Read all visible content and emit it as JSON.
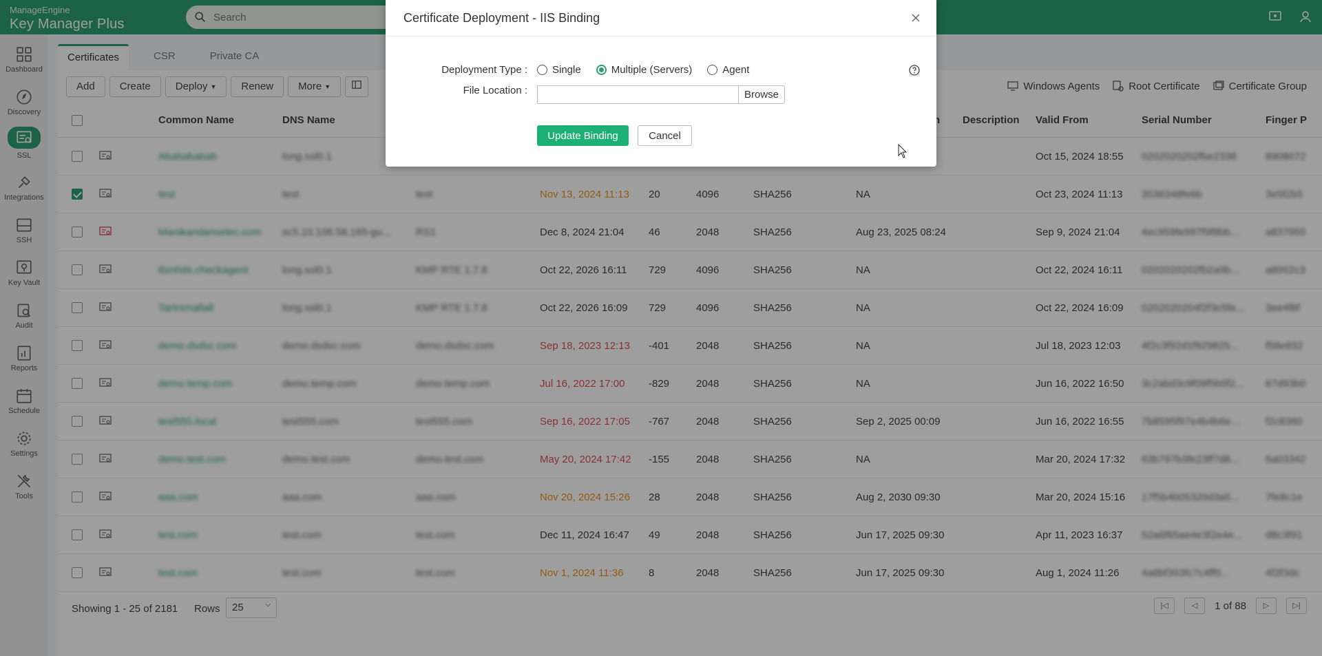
{
  "brand": {
    "vendor": "ManageEngine",
    "product": "Key Manager Plus"
  },
  "search": {
    "placeholder": "Search"
  },
  "sidebar": {
    "items": [
      {
        "label": "Dashboard",
        "icon": "dashboard-icon"
      },
      {
        "label": "Discovery",
        "icon": "discovery-icon"
      },
      {
        "label": "SSL",
        "icon": "ssl-icon",
        "active": true
      },
      {
        "label": "Integrations",
        "icon": "integrations-icon"
      },
      {
        "label": "SSH",
        "icon": "ssh-icon"
      },
      {
        "label": "Key Vault",
        "icon": "key-vault-icon"
      },
      {
        "label": "Audit",
        "icon": "audit-icon"
      },
      {
        "label": "Reports",
        "icon": "reports-icon"
      },
      {
        "label": "Schedule",
        "icon": "schedule-icon"
      },
      {
        "label": "Settings",
        "icon": "settings-icon"
      },
      {
        "label": "Tools",
        "icon": "tools-icon"
      }
    ]
  },
  "tabs": [
    {
      "label": "Certificates",
      "active": true
    },
    {
      "label": "CSR"
    },
    {
      "label": "Private CA"
    }
  ],
  "toolbar": {
    "add": "Add",
    "create": "Create",
    "deploy": "Deploy",
    "renew": "Renew",
    "more": "More"
  },
  "right_links": {
    "windows_agents": "Windows Agents",
    "root_certificate": "Root Certificate",
    "certificate_group": "Certificate Group"
  },
  "table": {
    "headers": {
      "common_name": "Common Name",
      "dns_name": "DNS Name",
      "col6_partial": "n",
      "description": "Description",
      "valid_from": "Valid From",
      "serial_number": "Serial Number",
      "finger": "Finger P"
    },
    "rows": [
      {
        "checked": false,
        "cn": "Ababababab",
        "dns": "long.ssl0.1",
        "issuer": "",
        "expiry": "",
        "expiry_color": "",
        "days": "",
        "key": "",
        "alg": "",
        "other": "",
        "valid_from": "Oct 15, 2024 18:55",
        "serial": "0202020202fbe2338",
        "finger": "8908072"
      },
      {
        "checked": true,
        "cn": "test",
        "dns": "test",
        "issuer": "test",
        "expiry": "Nov 13, 2024 11:13",
        "expiry_color": "orange",
        "days": "20",
        "key": "4096",
        "alg": "SHA256",
        "other": "NA",
        "valid_from": "Oct 23, 2024 11:13",
        "serial": "3536348fe6b",
        "finger": "3e5f2b5"
      },
      {
        "checked": false,
        "cn": "Manikandanselec.com",
        "dns": "sc5.10.106.58.165-gu...",
        "issuer": "RS1",
        "expiry": "Dec 8, 2024 21:04",
        "expiry_color": "",
        "days": "46",
        "key": "2048",
        "alg": "SHA256",
        "other": "Aug 23, 2025 08:24",
        "valid_from": "Sep 9, 2024 21:04",
        "serial": "4ec959fe997f9f8bbb3...",
        "finger": "a837955"
      },
      {
        "checked": false,
        "cn": "Ibmhds.checkagent",
        "dns": "long.ssl0.1",
        "issuer": "KMP RTE 1.7.8",
        "expiry": "Oct 22, 2026 16:11",
        "expiry_color": "",
        "days": "729",
        "key": "4096",
        "alg": "SHA256",
        "other": "NA",
        "valid_from": "Oct 22, 2024 16:11",
        "serial": "0202020202fb2a9b8...",
        "finger": "a8992c3"
      },
      {
        "checked": false,
        "cn": "Tartrsmallall",
        "dns": "long.ssl0.1",
        "issuer": "KMP RTE 1.7.8",
        "expiry": "Oct 22, 2026 16:09",
        "expiry_color": "",
        "days": "729",
        "key": "4096",
        "alg": "SHA256",
        "other": "NA",
        "valid_from": "Oct 22, 2024 16:09",
        "serial": "0202020204f2f3c5fe...",
        "finger": "3ee4f8f"
      },
      {
        "checked": false,
        "cn": "demo.dsdsc.com",
        "dns": "demo.dsdsc.com",
        "issuer": "demo.dsdsc.com",
        "expiry": "Sep 18, 2023 12:13",
        "expiry_color": "red",
        "days": "-401",
        "key": "2048",
        "alg": "SHA256",
        "other": "NA",
        "valid_from": "Jul 18, 2023 12:03",
        "serial": "4f2c3f92d1f929825...",
        "finger": "f58e832"
      },
      {
        "checked": false,
        "cn": "demo.temp.com",
        "dns": "demo.temp.com",
        "issuer": "demo.temp.com",
        "expiry": "Jul 16, 2022 17:00",
        "expiry_color": "red",
        "days": "-829",
        "key": "2048",
        "alg": "SHA256",
        "other": "NA",
        "valid_from": "Jun 16, 2022 16:50",
        "serial": "3c2abd3c9f09f5b0f2...",
        "finger": "67d93b0"
      },
      {
        "checked": false,
        "cn": "test555.local",
        "dns": "test555.com",
        "issuer": "test555.com",
        "expiry": "Sep 16, 2022 17:05",
        "expiry_color": "red",
        "days": "-767",
        "key": "2048",
        "alg": "SHA256",
        "other": "Sep 2, 2025 00:09",
        "valid_from": "Jun 16, 2022 16:55",
        "serial": "7b8595f97e4b4b6e3...",
        "finger": "f2c8360"
      },
      {
        "checked": false,
        "cn": "demo.test.com",
        "dns": "demo.test.com",
        "issuer": "demo.test.com",
        "expiry": "May 20, 2024 17:42",
        "expiry_color": "red",
        "days": "-155",
        "key": "2048",
        "alg": "SHA256",
        "other": "NA",
        "valid_from": "Mar 20, 2024 17:32",
        "serial": "63b797b3fe23ff7d8...",
        "finger": "6a03342"
      },
      {
        "checked": false,
        "cn": "aaa.com",
        "dns": "aaa.com",
        "issuer": "aaa.com",
        "expiry": "Nov 20, 2024 15:26",
        "expiry_color": "orange",
        "days": "28",
        "key": "2048",
        "alg": "SHA256",
        "other": "Aug 2, 2030 09:30",
        "valid_from": "Mar 20, 2024 15:16",
        "serial": "17f5b4b05320d3a5...",
        "finger": "7fe8c1e"
      },
      {
        "checked": false,
        "cn": "test.com",
        "dns": "test.com",
        "issuer": "test.com",
        "expiry": "Dec 11, 2024 16:47",
        "expiry_color": "",
        "days": "49",
        "key": "2048",
        "alg": "SHA256",
        "other": "Jun 17, 2025 09:30",
        "valid_from": "Apr 11, 2023 16:37",
        "serial": "52a6f65ae4e3f2e4e...",
        "finger": "d8c3f91"
      },
      {
        "checked": false,
        "cn": "test.com",
        "dns": "test.com",
        "issuer": "test.com",
        "expiry": "Nov 1, 2024 11:36",
        "expiry_color": "orange",
        "days": "8",
        "key": "2048",
        "alg": "SHA256",
        "other": "Jun 17, 2025 09:30",
        "valid_from": "Aug 1, 2024 11:26",
        "serial": "4a8bf393fc7c4ff0...",
        "finger": "4f2f3dc"
      }
    ]
  },
  "footer": {
    "showing": "Showing 1 - 25 of 2181",
    "rows_label": "Rows",
    "rows_value": "25",
    "page_info": "1 of 88"
  },
  "dialog": {
    "title": "Certificate Deployment - IIS Binding",
    "deployment_type_label": "Deployment Type :",
    "options": [
      "Single",
      "Multiple (Servers)",
      "Agent"
    ],
    "selected_option": "Multiple (Servers)",
    "file_location_label": "File Location :",
    "file_location_value": "",
    "browse_label": "Browse",
    "update_label": "Update Binding",
    "cancel_label": "Cancel"
  },
  "colors": {
    "brand": "#2e9e74",
    "primary_button": "#1db073",
    "warning": "#e8951f",
    "danger": "#d9534f"
  }
}
